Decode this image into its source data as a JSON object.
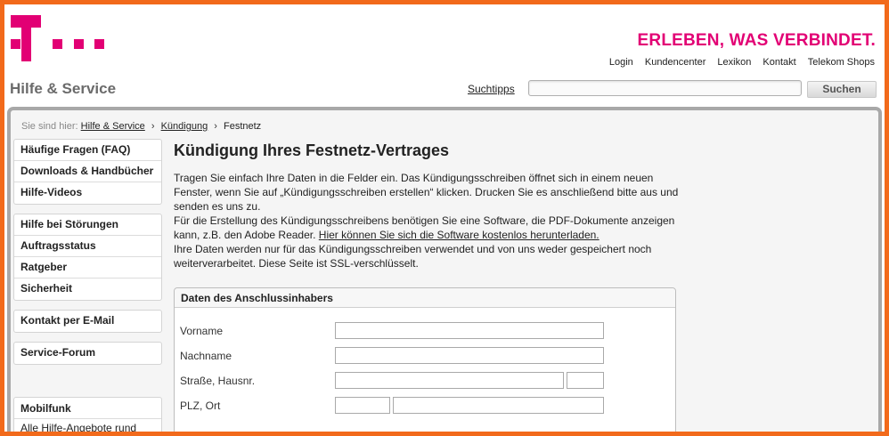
{
  "header": {
    "slogan": "ERLEBEN, WAS VERBINDET.",
    "top_links": [
      "Login",
      "Kundencenter",
      "Lexikon",
      "Kontakt",
      "Telekom Shops"
    ],
    "section_title": "Hilfe & Service",
    "suchtipps": "Suchtipps",
    "search_button": "Suchen",
    "search_value": "",
    "brand_color": "#e20074",
    "frame_color": "#f26a1b"
  },
  "breadcrumb": {
    "prefix": "Sie sind hier:",
    "items": [
      "Hilfe & Service",
      "Kündigung",
      "Festnetz"
    ]
  },
  "sidebar": {
    "group1": [
      "Häufige Fragen (FAQ)",
      "Downloads & Handbücher",
      "Hilfe-Videos"
    ],
    "group2": [
      "Hilfe bei Störungen",
      "Auftragsstatus",
      "Ratgeber",
      "Sicherheit"
    ],
    "group3": [
      "Kontakt per E-Mail"
    ],
    "group4": [
      "Service-Forum"
    ],
    "box": {
      "title": "Mobilfunk",
      "text": "Alle Hilfe-Angebote rund"
    }
  },
  "content": {
    "title": "Kündigung Ihres Festnetz-Vertrages",
    "p1": "Tragen Sie einfach Ihre Daten in die Felder ein. Das Kündigungsschreiben öffnet sich in einem neuen Fenster, wenn Sie auf „Kündigungsschreiben erstellen“ klicken. Drucken Sie es anschließend bitte aus und senden es uns zu.",
    "p2_text": "Für die Erstellung des Kündigungsschreibens benötigen Sie eine Software, die PDF-Dokumente anzeigen kann, z.B. den Adobe Reader. ",
    "p2_link": "Hier können Sie sich die Software kostenlos herunterladen.",
    "p3": "Ihre Daten werden nur für das Kündigungsschreiben verwendet und von uns weder gespeichert noch weiterverarbeitet. Diese Seite ist SSL-verschlüsselt."
  },
  "form": {
    "title": "Daten des Anschlussinhabers",
    "vorname_label": "Vorname",
    "nachname_label": "Nachname",
    "strasse_label": "Straße, Hausnr.",
    "plz_label": "PLZ, Ort",
    "vorname_value": "",
    "nachname_value": "",
    "strasse_value": "",
    "hausnr_value": "",
    "plz_value": "",
    "ort_value": ""
  }
}
